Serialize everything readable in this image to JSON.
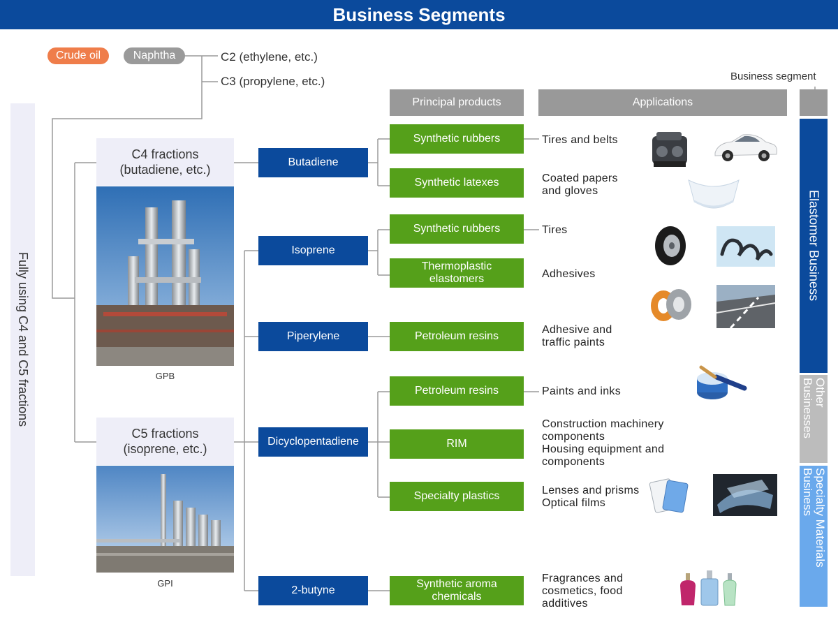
{
  "header": {
    "title": "Business Segments"
  },
  "feedstock": {
    "crude_oil": "Crude oil",
    "naphtha": "Naphtha",
    "c2": "C2 (ethylene, etc.)",
    "c3": "C3 (propylene, etc.)"
  },
  "side_label": "Fully using C4 and C5 fractions",
  "columns": {
    "principal_products": "Principal products",
    "applications": "Applications",
    "business_segment": "Business segment"
  },
  "fractions": {
    "c4_line1": "C4 fractions",
    "c4_line2": "(butadiene, etc.)",
    "c4_caption": "GPB",
    "c5_line1": "C5 fractions",
    "c5_line2": "(isoprene, etc.)",
    "c5_caption": "GPI"
  },
  "monomers": {
    "butadiene": "Butadiene",
    "isoprene": "Isoprene",
    "piperylene": "Piperylene",
    "dicyclopentadiene": "Dicyclopentadiene",
    "butyne": "2-butyne"
  },
  "products": {
    "p1": "Synthetic rubbers",
    "p2": "Synthetic latexes",
    "p3": "Synthetic rubbers",
    "p4_line1": "Thermoplastic",
    "p4_line2": "elastomers",
    "p5": "Petroleum resins",
    "p6": "Petroleum resins",
    "p7": "RIM",
    "p8": "Specialty plastics",
    "p9_line1": "Synthetic aroma",
    "p9_line2": "chemicals"
  },
  "applications": {
    "a1": "Tires and belts",
    "a2_line1": "Coated papers",
    "a2_line2": "and gloves",
    "a3": "Tires",
    "a4": "Adhesives",
    "a5_line1": "Adhesive and",
    "a5_line2": "traffic paints",
    "a6": "Paints and inks",
    "a7_line1": "Construction machinery",
    "a7_line2": "components",
    "a7_line3": "Housing equipment and",
    "a7_line4": "components",
    "a8_line1": "Lenses and prisms",
    "a8_line2": "Optical films",
    "a9_line1": "Fragrances and",
    "a9_line2": "cosmetics, food",
    "a9_line3": "additives"
  },
  "segments": {
    "elastomer": "Elastomer Business",
    "other": "Other Businesses",
    "specialty": "Specialty Materials Business"
  },
  "colors": {
    "header_blue": "#0b4a9c",
    "green": "#55a01a",
    "gray": "#999999",
    "orange": "#ef7d4a",
    "other_gray": "#bcbcbc",
    "specialty_blue": "#6aa9ec"
  },
  "icons": [
    "engine-icon",
    "car-icon",
    "diaper-icon",
    "tire-icon",
    "hose-icon",
    "tape-icon",
    "road-icon",
    "paint-can-icon",
    "tablet-icon",
    "optical-film-icon",
    "perfume-icon"
  ]
}
